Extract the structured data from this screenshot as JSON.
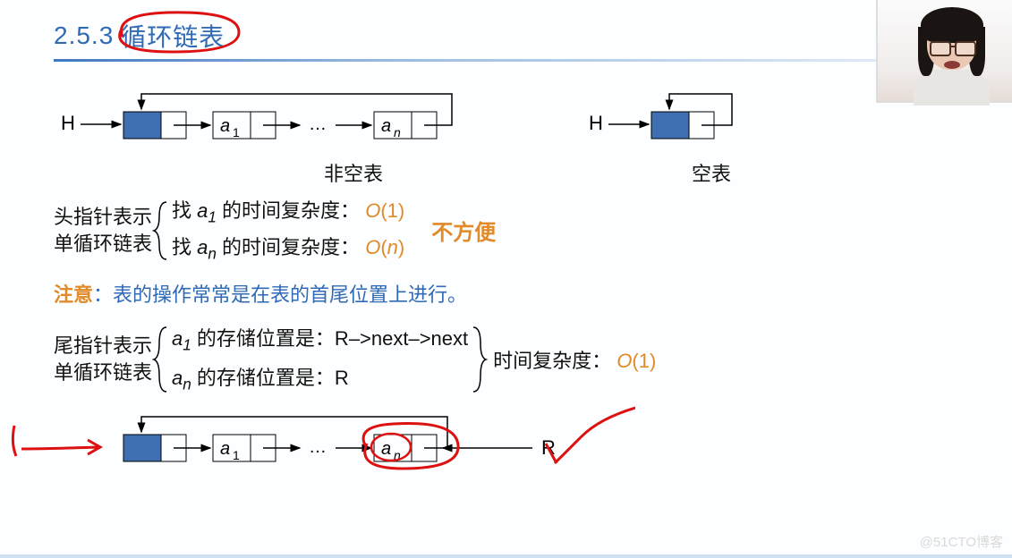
{
  "section_number": "2.5.3",
  "section_title": "循环链表",
  "diagram1": {
    "H": "H",
    "a1": "a",
    "a1_sub": "1",
    "dots": "…",
    "an": "a",
    "an_sub": "n",
    "label": "非空表"
  },
  "diagram2": {
    "H": "H",
    "label": "空表"
  },
  "head_ptr": {
    "label1": "头指针表示",
    "label2": "单循环链表",
    "line1_pre": "找 ",
    "line1_a": "a",
    "line1_sub": "1",
    "line1_post": " 的时间复杂度：",
    "line1_O": "O",
    "line1_val": "(1)",
    "line2_pre": "找 ",
    "line2_a": "a",
    "line2_sub": "n",
    "line2_post": " 的时间复杂度：",
    "line2_O": "O",
    "line2_val": "(",
    "line2_n": "n",
    "line2_close": ")",
    "note": "不方便"
  },
  "note_label": "注意",
  "note_text": "：表的操作常常是在表的首尾位置上进行。",
  "tail_ptr": {
    "label1": "尾指针表示",
    "label2": "单循环链表",
    "l1_a": "a",
    "l1_sub": "1",
    "l1_text": " 的存储位置是：R–>next–>next",
    "l2_a": "a",
    "l2_sub": "n",
    "l2_text": " 的存储位置是：R",
    "complexity_label": "时间复杂度：",
    "O": "O",
    "val": "(1)"
  },
  "diagram3": {
    "a1": "a",
    "a1_sub": "1",
    "dots": "…",
    "an": "a",
    "an_sub": "n",
    "R": "R"
  },
  "watermark": "@51CTO博客"
}
